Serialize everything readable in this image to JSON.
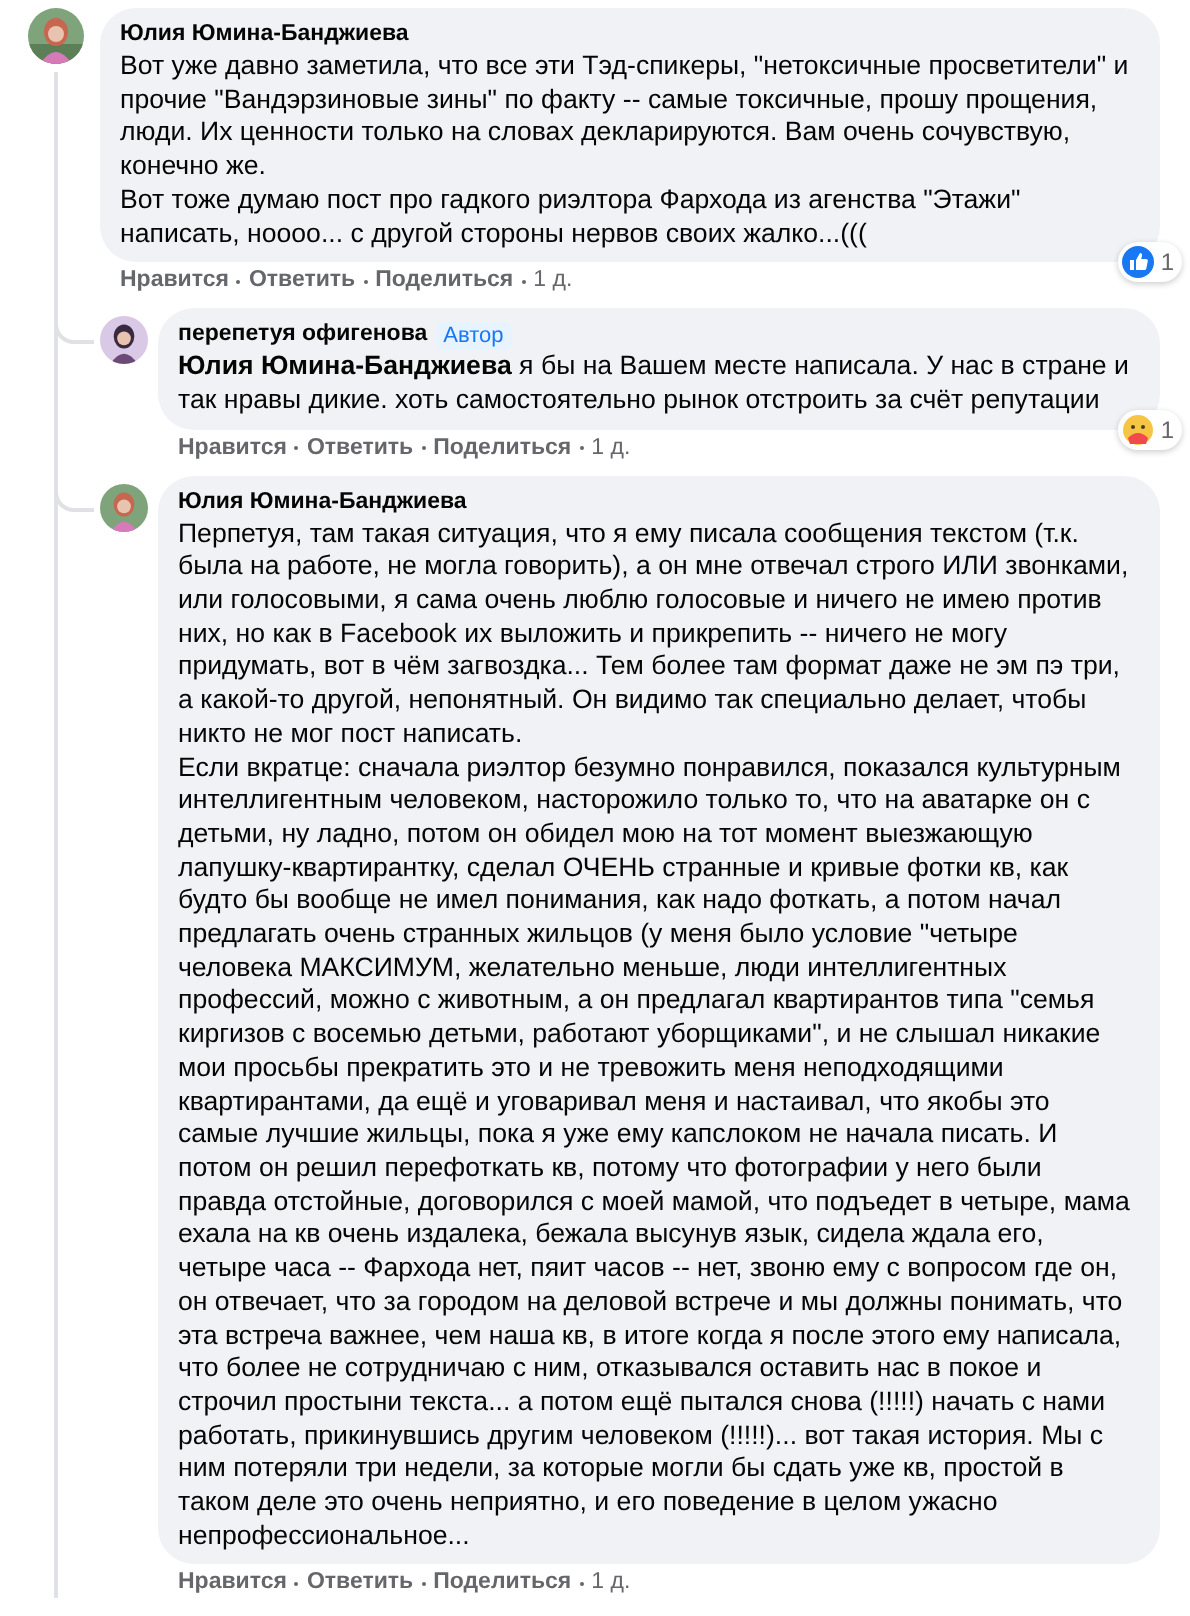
{
  "comments": [
    {
      "author": "Юлия Юмина-Банджиева",
      "paragraphs": [
        "Вот уже давно заметила, что все эти Тэд-спикеры, \"нетоксичные просветители\" и прочие \"Вандэрзиновые зины\" по факту -- самые токсичные, прошу прощения, люди. Их ценности только на словах декларируются. Вам очень сочувствую, конечно же.",
        "Вот тоже думаю пост про гадкого риэлтора Фархода из агенства \"Этажи\" написать, ноооо... с другой стороны нервов своих жалко...((("
      ],
      "actions": [
        "Нравится",
        "Ответить",
        "Поделиться"
      ],
      "time": "1 д.",
      "reaction": {
        "kind": "like",
        "count": "1"
      },
      "replies": [
        {
          "author": "перепетуя офигенова",
          "badge": "Автор",
          "paragraphs": [
            "**Юлия Юмина-Банджиева** я бы на Вашем месте написала. У нас в стране и так нравы дикие. хоть самостоятельно рынок отстроить за счёт репутации"
          ],
          "actions": [
            "Нравится",
            "Ответить",
            "Поделиться"
          ],
          "time": "1 д.",
          "reaction": {
            "kind": "care",
            "count": "1"
          }
        },
        {
          "author": "Юлия Юмина-Банджиева",
          "paragraphs": [
            "Перпетуя, там такая ситуация, что я ему писала сообщения текстом (т.к. была на работе, не могла говорить), а он мне отвечал строго ИЛИ звонками, или голосовыми, я сама очень люблю голосовые и ничего не имею против них, но как в Facebook их выложить и прикрепить -- ничего не могу придумать, вот в чём загвоздка... Тем более там формат даже не эм пэ три, а какой-то другой, непонятный. Он видимо так специально делает, чтобы никто не мог пост написать.",
            "Если вкратце: сначала риэлтор безумно понравился, показался культурным интеллигентным человеком, насторожило только то, что на аватарке он с детьми, ну ладно, потом он обидел мою на тот момент выезжающую лапушку-квартирантку, сделал ОЧЕНЬ странные и кривые фотки кв, как будто бы вообще не имел понимания, как надо фоткать, а потом начал предлагать очень странных жильцов (у меня было условие \"четыре человека МАКСИМУМ, желательно меньше, люди интеллигентных профессий, можно с животным, а он предлагал квартирантов типа \"семья киргизов с восемью детьми, работают уборщиками\", и не слышал никакие мои просьбы прекратить это и не тревожить меня неподходящими квартирантами, да ещё и уговаривал меня и настаивал, что якобы это самые лучшие жильцы, пока я уже ему капслоком не начала писать. И потом он решил перефоткать кв, потому что фотографии у него были правда отстойные, договорился с моей мамой, что подъедет в четыре, мама ехала на кв очень издалека, бежала высунув язык, сидела ждала его, четыре часа -- Фархода нет, пяит часов -- нет, звоню ему с вопросом где он, он отвечает, что за городом на деловой встрече и мы должны понимать, что эта встреча важнее, чем наша кв, в итоге когда я после этого ему написала, что более не сотрудничаю с ним, отказывался оставить нас в покое и строчил простыни текста... а потом ещё пытался снова (!!!!!) начать с нами работать, прикинувшись другим человеком (!!!!!)... вот такая история. Мы с ним потеряли три недели, за которые могли бы сдать уже кв, простой в таком деле это очень неприятно, и его поведение в целом ужасно непрофессиональное..."
          ],
          "actions": [
            "Нравится",
            "Ответить",
            "Поделиться"
          ],
          "time": "1 д."
        }
      ]
    }
  ]
}
